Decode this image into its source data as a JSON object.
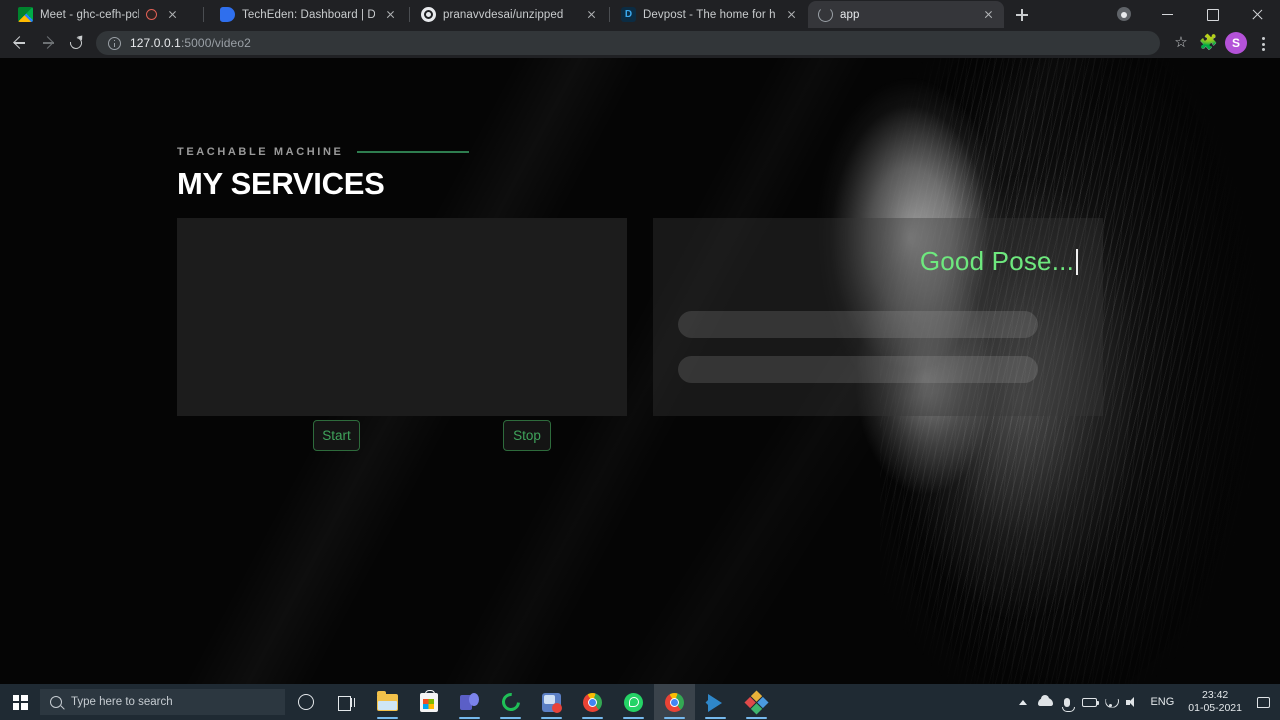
{
  "browser": {
    "tabs": [
      {
        "title": "Meet - ghc-cefh-pch",
        "favicon": "google-meet-icon",
        "recording": true,
        "active": false
      },
      {
        "title": "TechEden: Dashboard | Devfolio",
        "favicon": "devfolio-icon",
        "recording": false,
        "active": false
      },
      {
        "title": "pranavvdesai/unzipped",
        "favicon": "github-icon",
        "recording": false,
        "active": false
      },
      {
        "title": "Devpost - The home for hackath",
        "favicon": "devpost-icon",
        "recording": false,
        "active": false
      },
      {
        "title": "app",
        "favicon": "loading-icon",
        "recording": false,
        "active": true
      }
    ],
    "new_tab_label": "+",
    "window_controls": {
      "minimize": "minimize-icon",
      "maximize": "maximize-icon",
      "close": "close-icon",
      "profile": "profile-icon"
    },
    "toolbar": {
      "back": "back-arrow-icon",
      "forward": "forward-arrow-icon",
      "reload": "reload-icon",
      "site_info": "site-info-icon",
      "url_host": "127.0.0.1",
      "url_path": ":5000/video2",
      "bookmark": "star-icon",
      "extensions": "puzzle-icon",
      "avatar_initial": "S",
      "menu": "kebab-menu-icon"
    }
  },
  "page": {
    "eyebrow": "TEACHABLE MACHINE",
    "title": "MY SERVICES",
    "accent_green": "#2e7d4f",
    "pose_text_color": "#6ee87e",
    "video_panel": {
      "name": "webcam-preview"
    },
    "result_panel": {
      "pose_label": "Good Pose...",
      "bars": [
        {
          "name": "prediction-bar-1",
          "width_pct": 80
        },
        {
          "name": "prediction-bar-2",
          "width_pct": 80
        }
      ]
    },
    "buttons": {
      "start": "Start",
      "stop": "Stop"
    }
  },
  "taskbar": {
    "start": "windows-start-icon",
    "search_placeholder": "Type here to search",
    "apps": [
      {
        "name": "cortana",
        "icon": "cortana-icon",
        "running": false,
        "active": false
      },
      {
        "name": "task-view",
        "icon": "task-view-icon",
        "running": false,
        "active": false
      },
      {
        "name": "file-explorer",
        "icon": "file-explorer-icon",
        "running": true,
        "active": false
      },
      {
        "name": "microsoft-store",
        "icon": "microsoft-store-icon",
        "running": false,
        "active": false
      },
      {
        "name": "microsoft-teams",
        "icon": "microsoft-teams-icon",
        "running": true,
        "active": false
      },
      {
        "name": "spotify",
        "icon": "green-ring-icon",
        "running": true,
        "active": false
      },
      {
        "name": "photos",
        "icon": "photos-icon",
        "running": true,
        "active": false
      },
      {
        "name": "chrome-window-1",
        "icon": "chrome-icon",
        "running": true,
        "active": false
      },
      {
        "name": "whatsapp",
        "icon": "whatsapp-icon",
        "running": true,
        "active": false
      },
      {
        "name": "chrome-window-2",
        "icon": "chrome-icon",
        "running": true,
        "active": true
      },
      {
        "name": "visual-studio-code",
        "icon": "vscode-icon",
        "running": true,
        "active": false
      },
      {
        "name": "color-diamond-app",
        "icon": "diamond-icon",
        "running": true,
        "active": false
      }
    ],
    "tray": {
      "overflow": "chevron-up-icon",
      "onedrive": "cloud-icon",
      "microphone": "microphone-icon",
      "battery": "battery-icon",
      "wifi": "wifi-icon",
      "volume": "volume-icon",
      "language": "ENG",
      "time": "23:42",
      "date": "01-05-2021",
      "action_center": "action-center-icon"
    }
  }
}
